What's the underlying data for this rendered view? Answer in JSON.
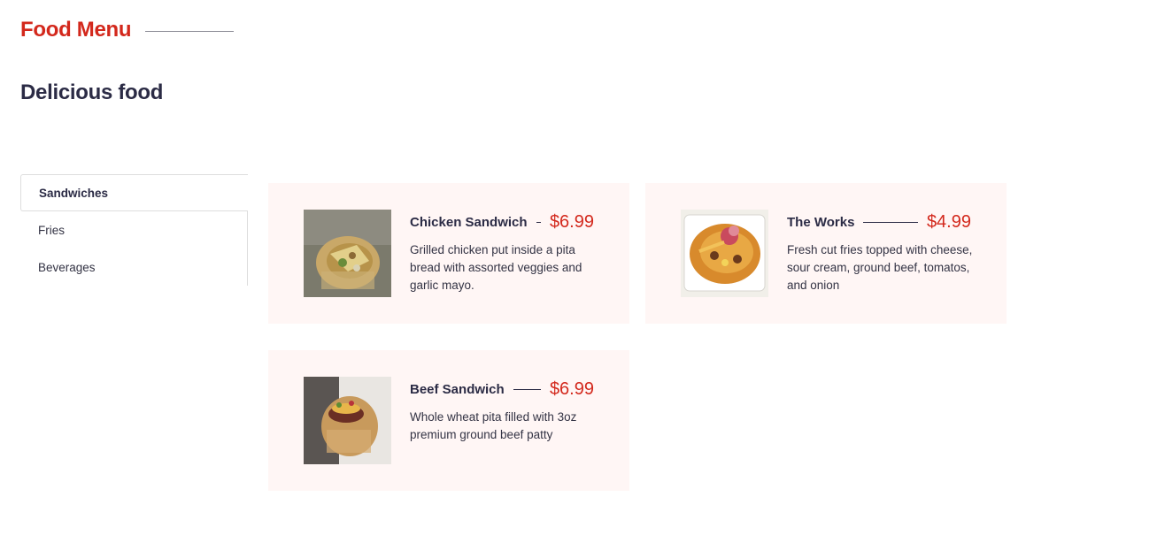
{
  "header": {
    "eyebrow": "Food Menu",
    "heading": "Delicious food"
  },
  "tabs": [
    {
      "label": "Sandwiches",
      "active": true
    },
    {
      "label": "Fries",
      "active": false
    },
    {
      "label": "Beverages",
      "active": false
    }
  ],
  "items": [
    {
      "name": "Chicken Sandwich",
      "price": "$6.99",
      "description": "Grilled chicken put inside a pita bread with assorted veggies and garlic mayo.",
      "image": "chicken-sandwich-photo"
    },
    {
      "name": "The Works",
      "price": "$4.99",
      "description": "Fresh cut fries topped with cheese, sour cream, ground beef, tomatos, and onion",
      "image": "loaded-fries-photo"
    },
    {
      "name": "Beef Sandwich",
      "price": "$6.99",
      "description": "Whole wheat pita filled with 3oz premium ground beef patty",
      "image": "beef-sandwich-photo"
    }
  ],
  "colors": {
    "accent": "#d3281c",
    "heading": "#2b2b45",
    "card_background": "#fff6f5"
  }
}
